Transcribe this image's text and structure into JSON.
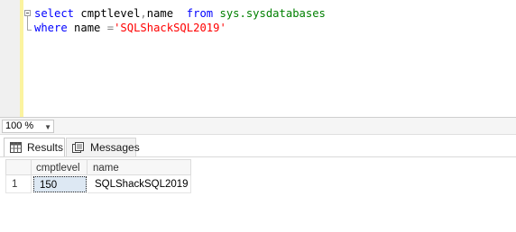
{
  "editor": {
    "line1": {
      "kw_select": "select",
      "col1": " cmptlevel",
      "comma": ",",
      "col2": "name  ",
      "kw_from": "from",
      "space": " ",
      "table": "sys.sysdatabases"
    },
    "line2": {
      "kw_where": "where",
      "field": " name ",
      "op": "=",
      "literal": "'SQLShackSQL2019'"
    }
  },
  "zoom": {
    "value": "100 %"
  },
  "tabs": [
    {
      "label": "Results",
      "icon": "grid-icon",
      "active": true
    },
    {
      "label": "Messages",
      "icon": "messages-icon",
      "active": false
    }
  ],
  "results": {
    "columns": [
      "cmptlevel",
      "name"
    ],
    "rows": [
      {
        "row_number": "1",
        "cells": [
          "150",
          "SQLShackSQL2019"
        ]
      }
    ]
  },
  "colors": {
    "keyword": "#0000ff",
    "system_object": "#008000",
    "string_literal": "#ff0000",
    "operator": "#808080",
    "change_bar": "#fbf39f",
    "selected_cell": "#dde8f3"
  }
}
